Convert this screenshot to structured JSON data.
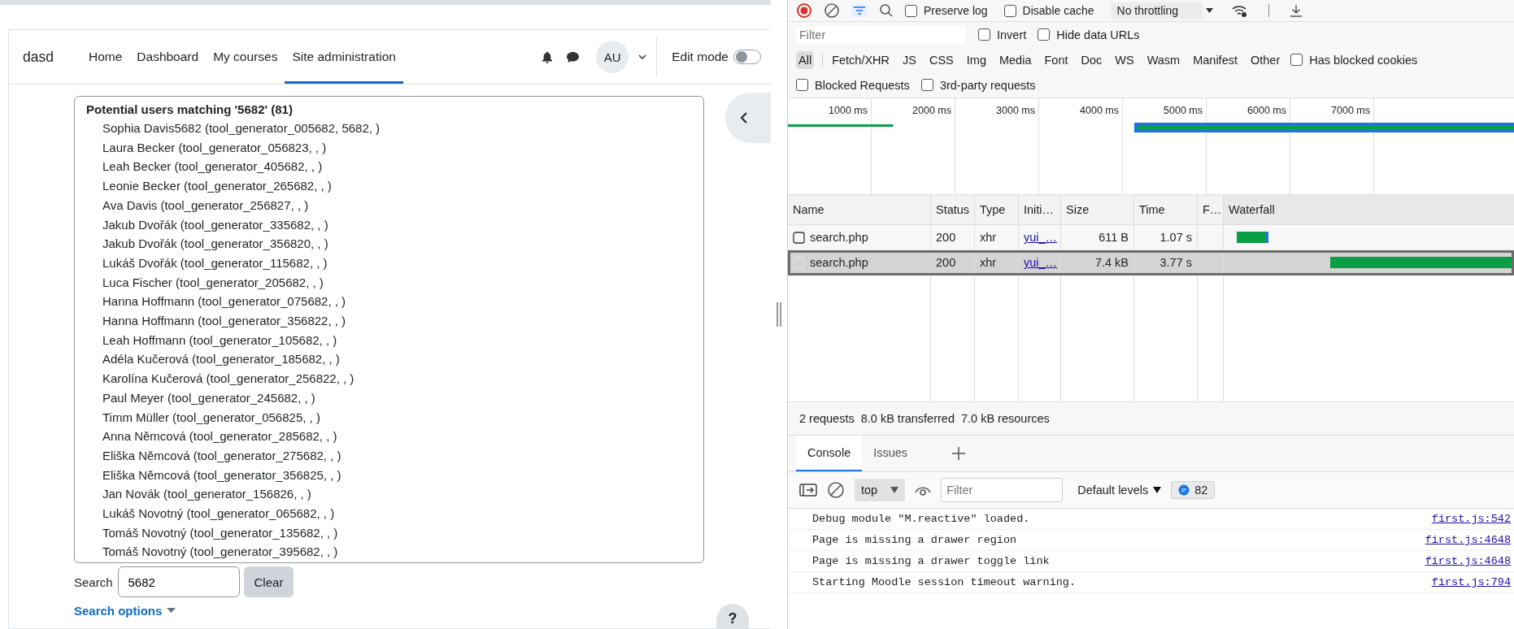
{
  "page": {
    "brand": "dasd",
    "nav": [
      {
        "label": "Home",
        "selected": false
      },
      {
        "label": "Dashboard",
        "selected": false
      },
      {
        "label": "My courses",
        "selected": false
      },
      {
        "label": "Site administration",
        "selected": true
      }
    ],
    "avatar": "AU",
    "edit_mode": {
      "label": "Edit mode",
      "on": false
    }
  },
  "user_list": {
    "heading": "Potential users matching '5682' (81)",
    "items": [
      "Sophia Davis5682 (tool_generator_005682, 5682, )",
      "Laura Becker (tool_generator_056823, , )",
      "Leah Becker (tool_generator_405682, , )",
      "Leonie Becker (tool_generator_265682, , )",
      "Ava Davis (tool_generator_256827, , )",
      "Jakub Dvořák (tool_generator_335682, , )",
      "Jakub Dvořák (tool_generator_356820, , )",
      "Lukáš Dvořák (tool_generator_115682, , )",
      "Luca Fischer (tool_generator_205682, , )",
      "Hanna Hoffmann (tool_generator_075682, , )",
      "Hanna Hoffmann (tool_generator_356822, , )",
      "Leah Hoffmann (tool_generator_105682, , )",
      "Adéla Kučerová (tool_generator_185682, , )",
      "Karolína Kučerová (tool_generator_256822, , )",
      "Paul Meyer (tool_generator_245682, , )",
      "Timm Müller (tool_generator_056825, , )",
      "Anna Němcová (tool_generator_285682, , )",
      "Eliška Němcová (tool_generator_275682, , )",
      "Eliška Němcová (tool_generator_356825, , )",
      "Jan Novák (tool_generator_156826, , )",
      "Lukáš Novotný (tool_generator_065682, , )",
      "Tomáš Novotný (tool_generator_135682, , )",
      "Tomáš Novotný (tool_generator_395682, , )"
    ]
  },
  "search": {
    "label": "Search",
    "value": "5682",
    "button": "Clear"
  },
  "search_options": "Search options",
  "help": "?",
  "devtools": {
    "toolbar": {
      "checkboxes": [
        {
          "label": "Preserve log",
          "checked": false
        },
        {
          "label": "Disable cache",
          "checked": false
        }
      ],
      "throttling": "No throttling"
    },
    "filter": {
      "placeholder": "Filter"
    },
    "filter_checkboxes": [
      {
        "label": "Invert",
        "checked": false
      },
      {
        "label": "Hide data URLs",
        "checked": false
      }
    ],
    "type_filters": [
      {
        "label": "All",
        "selected": true
      },
      {
        "label": "Fetch/XHR",
        "selected": false
      },
      {
        "label": "JS",
        "selected": false
      },
      {
        "label": "CSS",
        "selected": false
      },
      {
        "label": "Img",
        "selected": false
      },
      {
        "label": "Media",
        "selected": false
      },
      {
        "label": "Font",
        "selected": false
      },
      {
        "label": "Doc",
        "selected": false
      },
      {
        "label": "WS",
        "selected": false
      },
      {
        "label": "Wasm",
        "selected": false
      },
      {
        "label": "Manifest",
        "selected": false
      },
      {
        "label": "Other",
        "selected": false
      }
    ],
    "blocked_cookies": {
      "label": "Has blocked cookies",
      "checked": false
    },
    "request_checkboxes": [
      {
        "label": "Blocked Requests",
        "checked": false
      },
      {
        "label": "3rd-party requests",
        "checked": false
      }
    ],
    "overview_ticks": [
      "1000 ms",
      "2000 ms",
      "3000 ms",
      "4000 ms",
      "5000 ms",
      "6000 ms",
      "7000 ms"
    ],
    "table": {
      "columns": [
        "Name",
        "Status",
        "Type",
        "Initi…",
        "Size",
        "Time",
        "F…",
        "Waterfall"
      ],
      "rows": [
        {
          "name": "search.php",
          "status": "200",
          "type": "xhr",
          "initiator": "yui_…",
          "size": "611 B",
          "time": "1.07 s",
          "selected": false
        },
        {
          "name": "search.php",
          "status": "200",
          "type": "xhr",
          "initiator": "yui_…",
          "size": "7.4 kB",
          "time": "3.77 s",
          "selected": true
        }
      ]
    },
    "summary": [
      "2 requests",
      "8.0 kB transferred",
      "7.0 kB resources"
    ],
    "drawer_tabs": [
      {
        "label": "Console",
        "selected": true
      },
      {
        "label": "Issues",
        "selected": false
      }
    ],
    "console": {
      "context": "top",
      "filter_placeholder": "Filter",
      "levels": "Default levels",
      "message_count": "82",
      "messages": [
        {
          "text": "Debug module \"M.reactive\" loaded.",
          "source": "first.js:542"
        },
        {
          "text": "Page is missing a drawer region",
          "source": "first.js:4648"
        },
        {
          "text": "Page is missing a drawer toggle link",
          "source": "first.js:4648"
        },
        {
          "text": "Starting Moodle session timeout warning.",
          "source": "first.js:794"
        }
      ]
    }
  }
}
